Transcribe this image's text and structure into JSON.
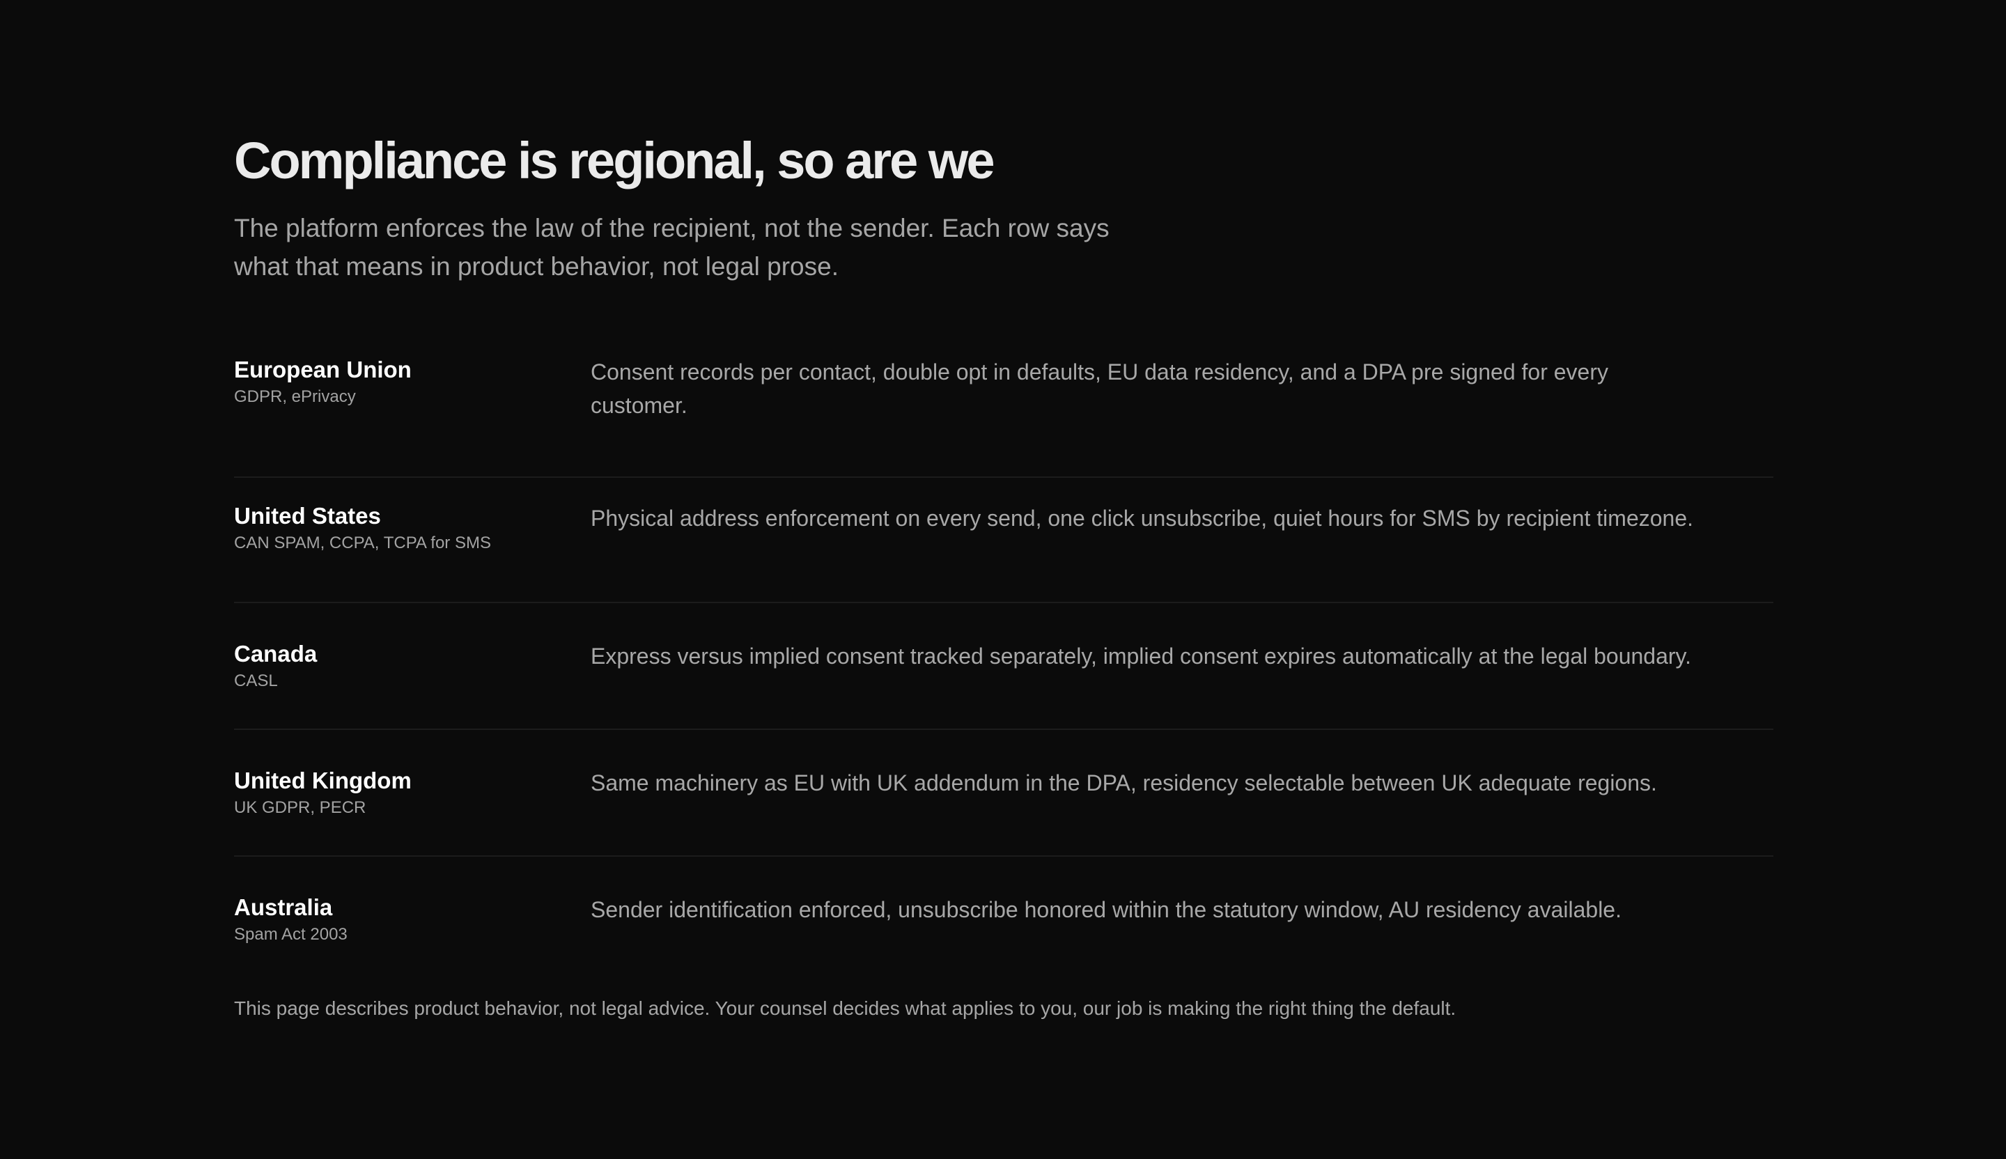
{
  "header": {
    "title": "Compliance is regional, so are we",
    "lede": "The platform enforces the law of the recipient, not the sender. Each row says what that means in product behavior, not legal prose."
  },
  "regions": [
    {
      "name": "European Union",
      "laws": "GDPR, ePrivacy",
      "behavior": "Consent records per contact, double opt in defaults, EU data residency, and a DPA pre signed for every customer."
    },
    {
      "name": "United States",
      "laws": "CAN SPAM, CCPA, TCPA for SMS",
      "behavior": "Physical address enforcement on every send, one click unsubscribe, quiet hours for SMS by recipient timezone."
    },
    {
      "name": "Canada",
      "laws": "CASL",
      "behavior": "Express versus implied consent tracked separately, implied consent expires automatically at the legal boundary."
    },
    {
      "name": "United Kingdom",
      "laws": "UK GDPR, PECR",
      "behavior": "Same machinery as EU with UK addendum in the DPA, residency selectable between UK adequate regions."
    },
    {
      "name": "Australia",
      "laws": "Spam Act 2003",
      "behavior": "Sender identification enforced, unsubscribe honored within the statutory window, AU residency available."
    }
  ],
  "footnote": "This page describes product behavior, not legal advice. Your counsel decides what applies to you, our job is making the right thing the default."
}
